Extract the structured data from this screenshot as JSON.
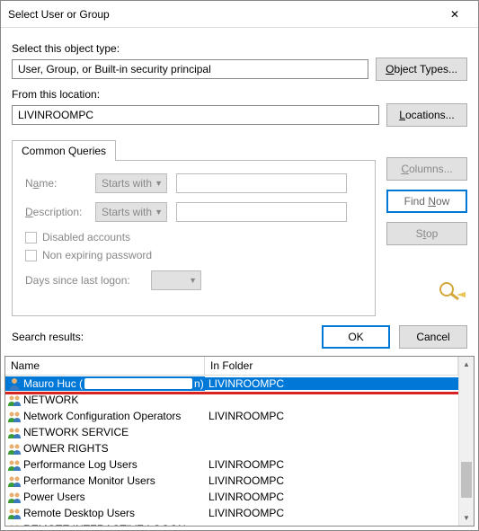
{
  "title": "Select User or Group",
  "labels": {
    "object_type": "Select this object type:",
    "from_location": "From this location:",
    "search_results": "Search results:"
  },
  "object_type_value": "User, Group, or Built-in security principal",
  "location_value": "LIVINROOMPC",
  "buttons": {
    "object_types": "Object Types...",
    "locations": "Locations...",
    "columns": "Columns...",
    "find_now": "Find Now",
    "stop": "Stop",
    "ok": "OK",
    "cancel": "Cancel"
  },
  "tab": {
    "common_queries": "Common Queries"
  },
  "queries": {
    "name_label": "Name:",
    "desc_label": "Description:",
    "starts_with": "Starts with",
    "disabled_accounts": "Disabled accounts",
    "non_expiring": "Non expiring password",
    "days_since": "Days since last logon:"
  },
  "columns": {
    "name": "Name",
    "in_folder": "In Folder"
  },
  "rows": [
    {
      "icon": "user",
      "name": "Mauro Huc (",
      "suffix": "n)",
      "folder": "LIVINROOMPC",
      "selected": true
    },
    {
      "icon": "group",
      "name": "NETWORK",
      "folder": ""
    },
    {
      "icon": "group",
      "name": "Network Configuration Operators",
      "folder": "LIVINROOMPC"
    },
    {
      "icon": "group",
      "name": "NETWORK SERVICE",
      "folder": ""
    },
    {
      "icon": "group",
      "name": "OWNER RIGHTS",
      "folder": ""
    },
    {
      "icon": "group",
      "name": "Performance Log Users",
      "folder": "LIVINROOMPC"
    },
    {
      "icon": "group",
      "name": "Performance Monitor Users",
      "folder": "LIVINROOMPC"
    },
    {
      "icon": "group",
      "name": "Power Users",
      "folder": "LIVINROOMPC"
    },
    {
      "icon": "group",
      "name": "Remote Desktop Users",
      "folder": "LIVINROOMPC"
    },
    {
      "icon": "group",
      "name": "REMOTE INTERACTIVE LOGON",
      "folder": ""
    }
  ]
}
